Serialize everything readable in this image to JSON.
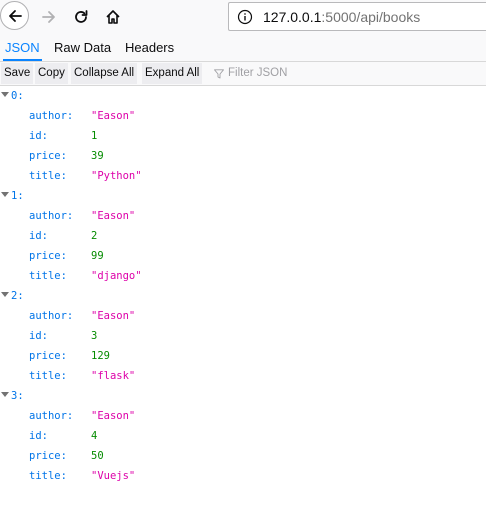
{
  "browser": {
    "url_host": "127.0.0.1",
    "url_path": ":5000/api/books"
  },
  "tabs": [
    "JSON",
    "Raw Data",
    "Headers"
  ],
  "toolbar": {
    "save": "Save",
    "copy": "Copy",
    "collapse_all": "Collapse All",
    "expand_all": "Expand All",
    "filter_placeholder": "Filter JSON"
  },
  "json": [
    {
      "index": "0:",
      "author": "\"Eason\"",
      "id": "1",
      "price": "39",
      "title": "\"Python\""
    },
    {
      "index": "1:",
      "author": "\"Eason\"",
      "id": "2",
      "price": "99",
      "title": "\"django\""
    },
    {
      "index": "2:",
      "author": "\"Eason\"",
      "id": "3",
      "price": "129",
      "title": "\"flask\""
    },
    {
      "index": "3:",
      "author": "\"Eason\"",
      "id": "4",
      "price": "50",
      "title": "\"Vuejs\""
    }
  ],
  "keys": {
    "author": "author:",
    "id": "id:",
    "price": "price:",
    "title": "title:"
  },
  "colors": {
    "key": "#0074e8",
    "string": "#dd00a9",
    "number": "#058b00",
    "accent": "#0a84ff"
  }
}
